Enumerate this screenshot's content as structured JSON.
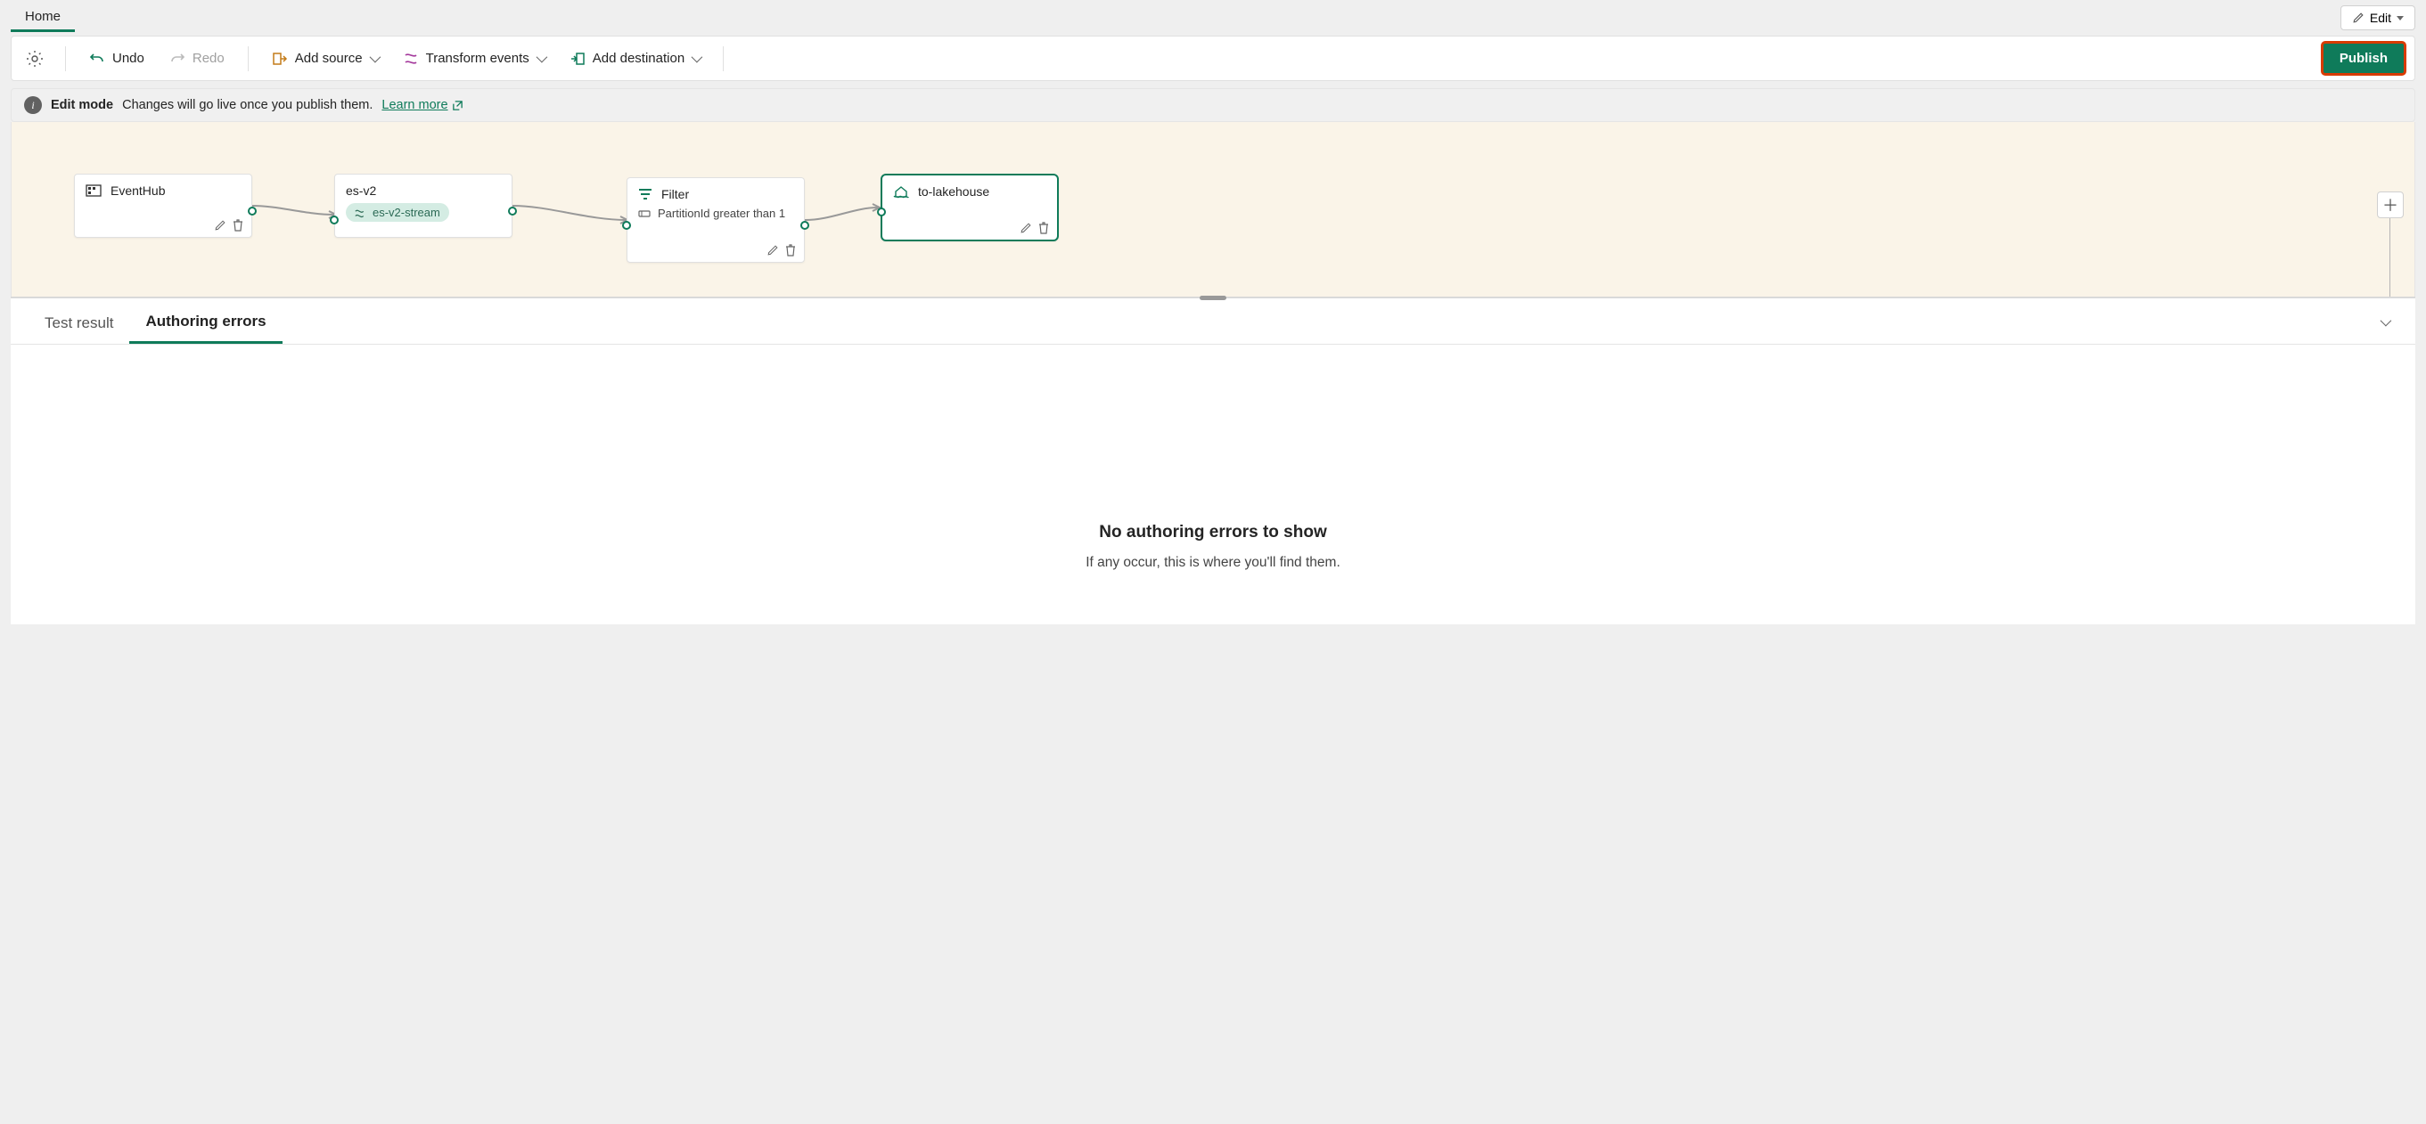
{
  "topbar": {
    "home_tab": "Home",
    "edit_btn": "Edit"
  },
  "toolbar": {
    "undo": "Undo",
    "redo": "Redo",
    "add_source": "Add source",
    "transform_events": "Transform events",
    "add_destination": "Add destination",
    "publish": "Publish"
  },
  "infobar": {
    "label": "Edit mode",
    "message": "Changes will go live once you publish them.",
    "learn_more": "Learn more"
  },
  "nodes": {
    "eventhub": {
      "title": "EventHub"
    },
    "stream": {
      "title": "es-v2",
      "chip": "es-v2-stream"
    },
    "filter": {
      "title": "Filter",
      "subtitle": "PartitionId greater than 1"
    },
    "dest": {
      "title": "to-lakehouse"
    }
  },
  "tabs": {
    "test_result": "Test result",
    "authoring_errors": "Authoring errors"
  },
  "empty": {
    "title": "No authoring errors to show",
    "subtitle": "If any occur, this is where you'll find them."
  }
}
